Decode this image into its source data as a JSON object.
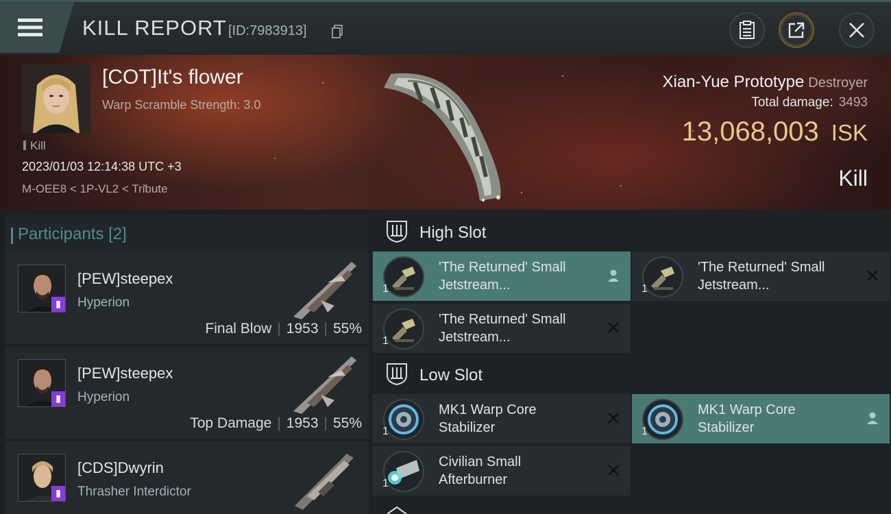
{
  "header": {
    "title": "KILL REPORT",
    "report_id": "[ID:7983913]",
    "colors": {
      "accent": "#4f8c8a",
      "isk": "#e9c88a",
      "selected_module": "#4a7a74"
    },
    "icons": [
      "menu-icon",
      "copy-icon",
      "clipboard-icon",
      "share-icon",
      "close-icon"
    ]
  },
  "victim": {
    "name": "[COT]It's flower",
    "warp_scramble": "Warp Scramble Strength: 3.0",
    "tag": "Kill",
    "datetime": "2023/01/03 12:14:38 UTC +3",
    "location": "M-OEE8 < 1P-VL2 < Tribute",
    "ship_name": "Xian-Yue Prototype",
    "ship_class": "Destroyer",
    "total_damage_label": "Total damage:",
    "total_damage": "3493",
    "isk_value": "13,068,003",
    "isk_unit": "ISK",
    "kill_type": "Kill"
  },
  "participants": {
    "label": "Participants",
    "count": "[2]",
    "rows": [
      {
        "name": "[PEW]steepex",
        "ship": "Hyperion",
        "role": "Final Blow",
        "damage": "1953",
        "percent": "55%"
      },
      {
        "name": "[PEW]steepex",
        "ship": "Hyperion",
        "role": "Top Damage",
        "damage": "1953",
        "percent": "55%"
      },
      {
        "name": "[CDS]Dwyrin",
        "ship": "Thrasher Interdictor",
        "role": "",
        "damage": "",
        "percent": ""
      }
    ]
  },
  "fitting": {
    "high_slot": {
      "label": "High Slot",
      "modules": [
        {
          "qty": "1",
          "line1": "'The Returned' Small",
          "line2": "Jetstream...",
          "icon": "cannon-icon",
          "action": "person-icon",
          "selected": true
        },
        {
          "qty": "1",
          "line1": "'The Returned' Small",
          "line2": "Jetstream...",
          "icon": "cannon-icon",
          "action": "x-icon",
          "selected": false
        },
        {
          "qty": "1",
          "line1": "'The Returned' Small",
          "line2": "Jetstream...",
          "icon": "cannon-icon",
          "action": "x-icon",
          "selected": false
        }
      ]
    },
    "low_slot": {
      "label": "Low Slot",
      "modules": [
        {
          "qty": "1",
          "line1": "MK1 Warp Core",
          "line2": "Stabilizer",
          "icon": "warp-core-icon",
          "action": "x-icon",
          "selected": false
        },
        {
          "qty": "1",
          "line1": "MK1 Warp Core",
          "line2": "Stabilizer",
          "icon": "warp-core-icon",
          "action": "person-icon",
          "selected": true
        },
        {
          "qty": "1",
          "line1": "Civilian Small",
          "line2": "Afterburner",
          "icon": "afterburner-icon",
          "action": "x-icon",
          "selected": false
        }
      ]
    }
  }
}
